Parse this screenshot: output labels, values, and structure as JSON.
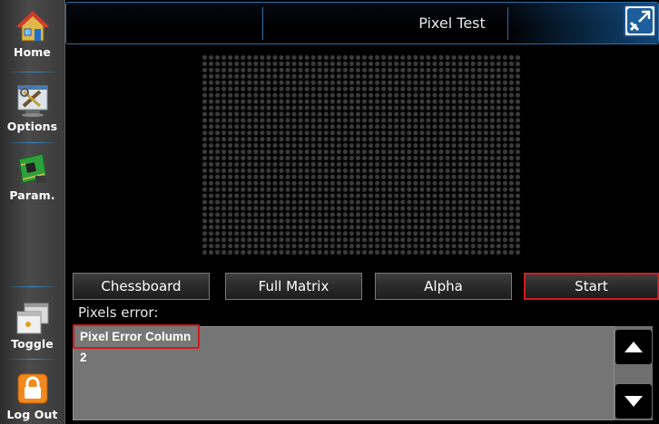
{
  "header": {
    "title": "Pixel Test"
  },
  "sidebar": {
    "items": [
      {
        "label": "Home",
        "icon": "home-icon"
      },
      {
        "label": "Options",
        "icon": "tools-icon"
      },
      {
        "label": "Param.",
        "icon": "circuit-board-icon"
      },
      {
        "label": "Toggle",
        "icon": "window-toggle-icon"
      },
      {
        "label": "Log Out",
        "icon": "lock-icon"
      }
    ]
  },
  "toolbar": {
    "buttons": [
      {
        "label": "Chessboard"
      },
      {
        "label": "Full Matrix"
      },
      {
        "label": "Alpha"
      },
      {
        "label": "Start",
        "active": true
      }
    ]
  },
  "errors": {
    "label": "Pixels error:",
    "items": [
      "Pixel Error Column 2"
    ]
  },
  "colors": {
    "accent_blue": "#2f6fa8",
    "highlight_red": "#d21b1b",
    "list_bg": "#757575"
  }
}
